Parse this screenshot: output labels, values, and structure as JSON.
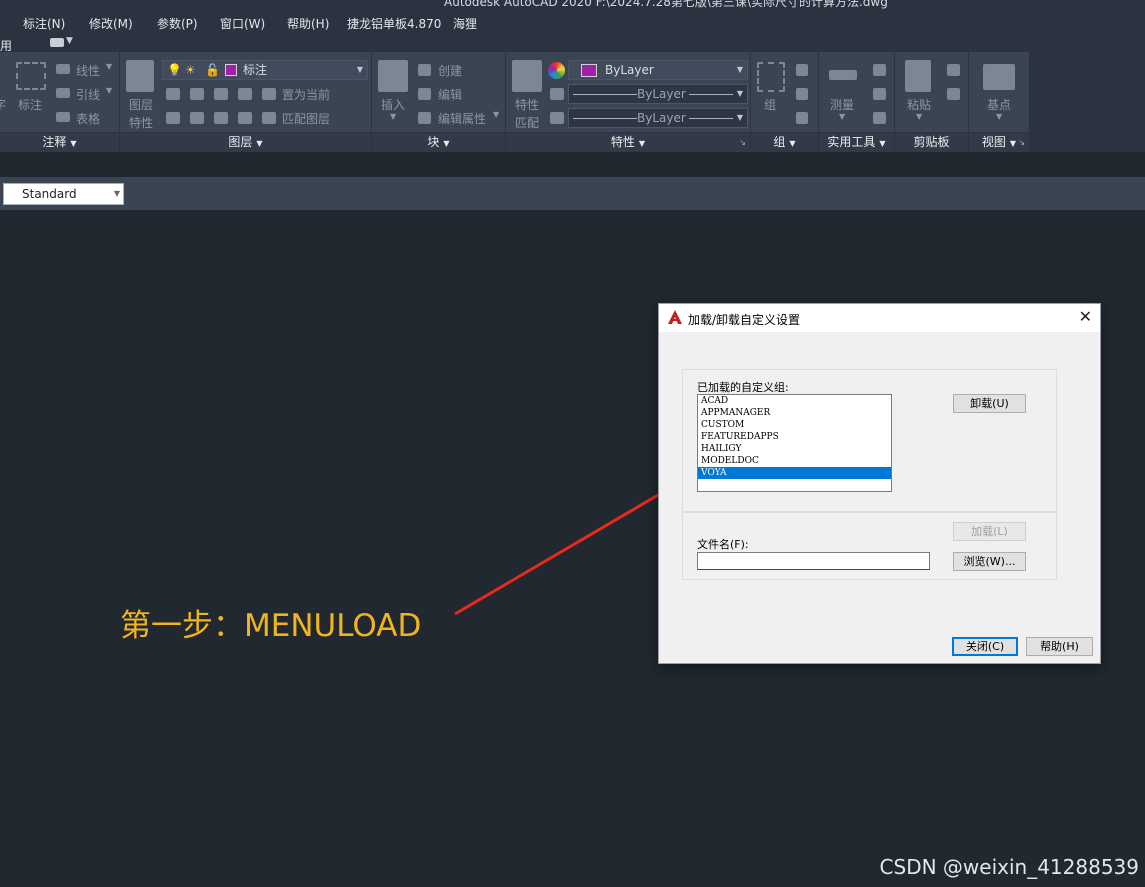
{
  "window": {
    "title": "Autodesk AutoCAD 2020    F:\\2024.7.28第七版\\第三课\\实际尺寸的计算方法.dwg"
  },
  "menubar": {
    "items": [
      "标注(N)",
      "修改(M)",
      "参数(P)",
      "窗口(W)",
      "帮助(H)",
      "捷龙铝单板4.870",
      "海狸"
    ]
  },
  "tabrow": {
    "tab_label": "应用"
  },
  "ribbon": {
    "annotation": {
      "footer": "注释",
      "linear_label": "线性",
      "leader_label": "引线",
      "table_label": "表格",
      "dim_label": "标注",
      "text_label": "字"
    },
    "layers": {
      "footer": "图层",
      "layer_props_label_1": "图层",
      "layer_props_label_2": "特性",
      "current_layer": "标注",
      "set_current_label": "置为当前",
      "match_layer_label": "匹配图层"
    },
    "block": {
      "footer": "块",
      "insert_label": "插入",
      "create_label": "创建",
      "edit_label": "编辑",
      "edit_attr_label": "编辑属性"
    },
    "properties": {
      "footer": "特性",
      "match_label_1": "特性",
      "match_label_2": "匹配",
      "color_value": "ByLayer",
      "linetype_value": "ByLayer",
      "lineweight_value": "ByLayer"
    },
    "groups": {
      "footer": "组",
      "group_label": "组"
    },
    "utilities": {
      "footer": "实用工具",
      "measure_label": "测量"
    },
    "clipboard": {
      "footer": "剪贴板",
      "paste_label": "粘贴"
    },
    "view": {
      "footer": "视图",
      "base_label": "基点"
    }
  },
  "stylebar": {
    "style_value": "Standard"
  },
  "annotation": {
    "step_text": "第一步：MENULOAD",
    "arrow_color": "#e8291d",
    "text_color": "#f0b41e"
  },
  "dialog": {
    "title": "加载/卸载自定义设置",
    "loaded_groups_label": "已加载的自定义组:",
    "groups": [
      "ACAD",
      "APPMANAGER",
      "CUSTOM",
      "FEATUREDAPPS",
      "HAILIGY",
      "MODELDOC",
      "VOYA"
    ],
    "selected_group": "VOYA",
    "unload_button": "卸载(U)",
    "load_button": "加载(L)",
    "filename_label": "文件名(F):",
    "filename_value": "",
    "browse_button": "浏览(W)...",
    "close_button": "关闭(C)",
    "help_button": "帮助(H)"
  },
  "watermark": "CSDN @weixin_41288539"
}
